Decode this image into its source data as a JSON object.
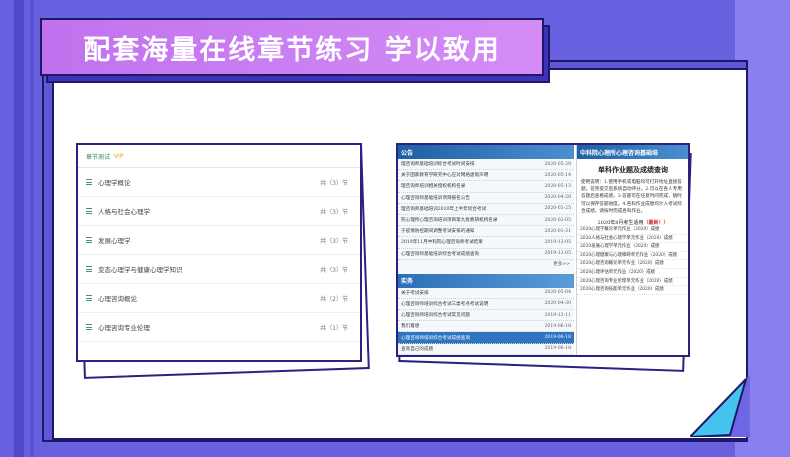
{
  "banner": {
    "title": "配套海量在线章节练习 学以致用"
  },
  "chapter_card": {
    "tab": "章节测试",
    "vip": "·VIP",
    "rows": [
      {
        "title": "心理学概论",
        "count": "共（3）节"
      },
      {
        "title": "人格与社会心理学",
        "count": "共（3）节"
      },
      {
        "title": "发展心理学",
        "count": "共（3）节"
      },
      {
        "title": "变态心理学与健康心理学知识",
        "count": "共（3）节"
      },
      {
        "title": "心理咨询概论",
        "count": "共（2）节"
      },
      {
        "title": "心理咨询专业伦理",
        "count": "共（1）节"
      }
    ]
  },
  "portal_card": {
    "news_header": "公告",
    "news": [
      {
        "t": "理咨询师基础培训综合考试时间安排",
        "d": "2020-05-29"
      },
      {
        "t": "关于国家教育学研究中心应对网络虚假声明",
        "d": "2020-05-14"
      },
      {
        "t": "理咨询师培训相关授权机构名录",
        "d": "2020-05-13"
      },
      {
        "t": "心理咨询师基础培训项目报名公告",
        "d": "2020-04-28"
      },
      {
        "t": "理咨询师基础培训2020年上半年综合考试",
        "d": "2020-03-25"
      },
      {
        "t": "院心理所心理咨询培训项目第九批教研机构名录",
        "d": "2020-02-05"
      },
      {
        "t": "于疫情防控期间调整考试安排的通知",
        "d": "2020-01-31"
      },
      {
        "t": "2019年11月中科院心理咨询师考试结果",
        "d": "2019-12-05"
      },
      {
        "t": "心理咨询师基础培训综合考试成绩查询",
        "d": "2019-12-05"
      }
    ],
    "news_more": "更多>>",
    "practice_header": "实务",
    "practice": [
      {
        "t": "关于考试安排",
        "d": "2020-05-04"
      },
      {
        "t": "心理咨询师培训综合考试三类考点考试说明",
        "d": "2020-04-30"
      },
      {
        "t": "心理咨询师培训综合考试常见问题",
        "d": "2019-12-11"
      },
      {
        "t": "我们着想",
        "d": "2019-06-18"
      },
      {
        "t": "心理咨询师培训综合考试成绩查询",
        "d": "2019-06-18",
        "hl": true
      },
      {
        "t": "查询自己的成绩",
        "d": "2019-06-18"
      }
    ],
    "right_header": "中科院心理所心理咨询基础培",
    "right_title": "单科作业题及成绩查询",
    "right_body": "使用说明：1.使用手机或电脑均可打开地址直接答题。答完提交后系统自动评分。2.可以在各人专用答题后查看成绩。3.答题可在任意时间完成，随时可以保存答题进度。4.各科作业成绩均计入考试综合成绩，请按时完成各科作业。",
    "right_season": "2020年8月考生适用",
    "right_new": "（最新！）",
    "right_items": [
      "2020心理学概论单元作业（2020）成绩",
      "2020人格与社会心理学单元作业（2020）成绩",
      "2020发展心理学单元作业（2020）成绩",
      "2020心理健康与心理障碍单元作业（2020）成绩",
      "2020心理咨询概论单元作业（2020）成绩",
      "2020心理评估单元作业（2020）成绩",
      "2020心理咨询专业伦理单元作业（2020）成绩",
      "2020心理咨询技能单元作业（2020）成绩"
    ]
  }
}
